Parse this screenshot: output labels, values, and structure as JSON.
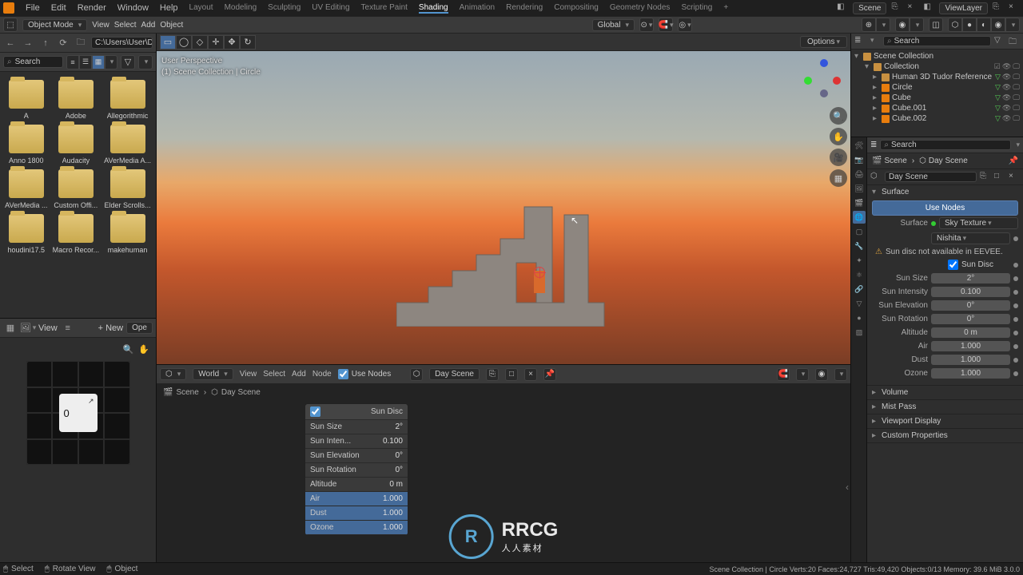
{
  "menubar": {
    "items": [
      "File",
      "Edit",
      "Render",
      "Window",
      "Help"
    ],
    "workspaces": [
      "Layout",
      "Modeling",
      "Sculpting",
      "UV Editing",
      "Texture Paint",
      "Shading",
      "Animation",
      "Rendering",
      "Compositing",
      "Geometry Nodes",
      "Scripting"
    ],
    "active_workspace": "Shading",
    "scene_label": "Scene",
    "viewlayer_label": "ViewLayer"
  },
  "toolbar": {
    "mode": "Object Mode",
    "menus": [
      "View",
      "Select",
      "Add",
      "Object"
    ],
    "orientation": "Global"
  },
  "filebrowser": {
    "path": "C:\\Users\\User\\Docu...",
    "search_placeholder": "Search",
    "new_label": "New",
    "op_label": "Ope",
    "view_label": "View",
    "folders": [
      {
        "label": "A"
      },
      {
        "label": "Adobe"
      },
      {
        "label": "Allegorithmic"
      },
      {
        "label": "Anno 1800"
      },
      {
        "label": "Audacity"
      },
      {
        "label": "AVerMedia A..."
      },
      {
        "label": "AVerMedia ..."
      },
      {
        "label": "Custom Offi..."
      },
      {
        "label": "Elder Scrolls..."
      },
      {
        "label": "houdini17.5"
      },
      {
        "label": "Macro Recor..."
      },
      {
        "label": "makehuman"
      }
    ],
    "preview_value": "0"
  },
  "viewport": {
    "persp": "User Perspective",
    "context": "(1) Scene Collection | Circle",
    "options_label": "Options",
    "watermark_title": "RRCG",
    "watermark_sub": "人人素材"
  },
  "nodeeditor": {
    "type": "World",
    "menus": [
      "View",
      "Select",
      "Add",
      "Node"
    ],
    "use_nodes_label": "Use Nodes",
    "datablock": "Day Scene",
    "crumb_scene": "Scene",
    "crumb_world": "Day Scene",
    "node": {
      "header": "Sun Disc",
      "rows": [
        {
          "label": "Sun Size",
          "value": "2°",
          "in": false
        },
        {
          "label": "Sun Inten...",
          "value": "0.100",
          "in": false
        },
        {
          "label": "Sun Elevation",
          "value": "0°",
          "in": false
        },
        {
          "label": "Sun Rotation",
          "value": "0°",
          "in": false
        },
        {
          "label": "Altitude",
          "value": "0 m",
          "in": false
        },
        {
          "label": "Air",
          "value": "1.000",
          "in": true
        },
        {
          "label": "Dust",
          "value": "1.000",
          "in": true
        },
        {
          "label": "Ozone",
          "value": "1.000",
          "in": true
        }
      ]
    }
  },
  "outliner": {
    "search_placeholder": "Search",
    "root": "Scene Collection",
    "items": [
      {
        "label": "Collection",
        "depth": 1,
        "type": "coll"
      },
      {
        "label": "Human 3D Tudor Reference",
        "depth": 2,
        "type": "coll"
      },
      {
        "label": "Circle",
        "depth": 2,
        "type": "mesh"
      },
      {
        "label": "Cube",
        "depth": 2,
        "type": "mesh"
      },
      {
        "label": "Cube.001",
        "depth": 2,
        "type": "mesh"
      },
      {
        "label": "Cube.002",
        "depth": 2,
        "type": "mesh"
      }
    ]
  },
  "properties": {
    "search_placeholder": "Search",
    "crumb_scene": "Scene",
    "crumb_world": "Day Scene",
    "world_name": "Day Scene",
    "surface_section": "Surface",
    "use_nodes_btn": "Use Nodes",
    "surface_label": "Surface",
    "surface_value": "Sky Texture",
    "sky_model": "Nishita",
    "eevee_warning": "Sun disc not available in EEVEE.",
    "sun_disc_label": "Sun Disc",
    "rows": [
      {
        "label": "Sun Size",
        "value": "2°"
      },
      {
        "label": "Sun Intensity",
        "value": "0.100"
      },
      {
        "label": "Sun Elevation",
        "value": "0°"
      },
      {
        "label": "Sun Rotation",
        "value": "0°"
      },
      {
        "label": "Altitude",
        "value": "0 m"
      },
      {
        "label": "Air",
        "value": "1.000"
      },
      {
        "label": "Dust",
        "value": "1.000"
      },
      {
        "label": "Ozone",
        "value": "1.000"
      }
    ],
    "collapsed_sections": [
      "Volume",
      "Mist Pass",
      "Viewport Display",
      "Custom Properties"
    ]
  },
  "statusbar": {
    "left": [
      {
        "icon": "🖱",
        "text": "Select"
      },
      {
        "icon": "🖱",
        "text": "Rotate View"
      },
      {
        "icon": "🖱",
        "text": "Object"
      }
    ],
    "stats": "Scene Collection | Circle    Verts:20    Faces:24,727    Tris:49,420    Objects:0/13    Memory: 39.6 MiB    3.0.0"
  }
}
